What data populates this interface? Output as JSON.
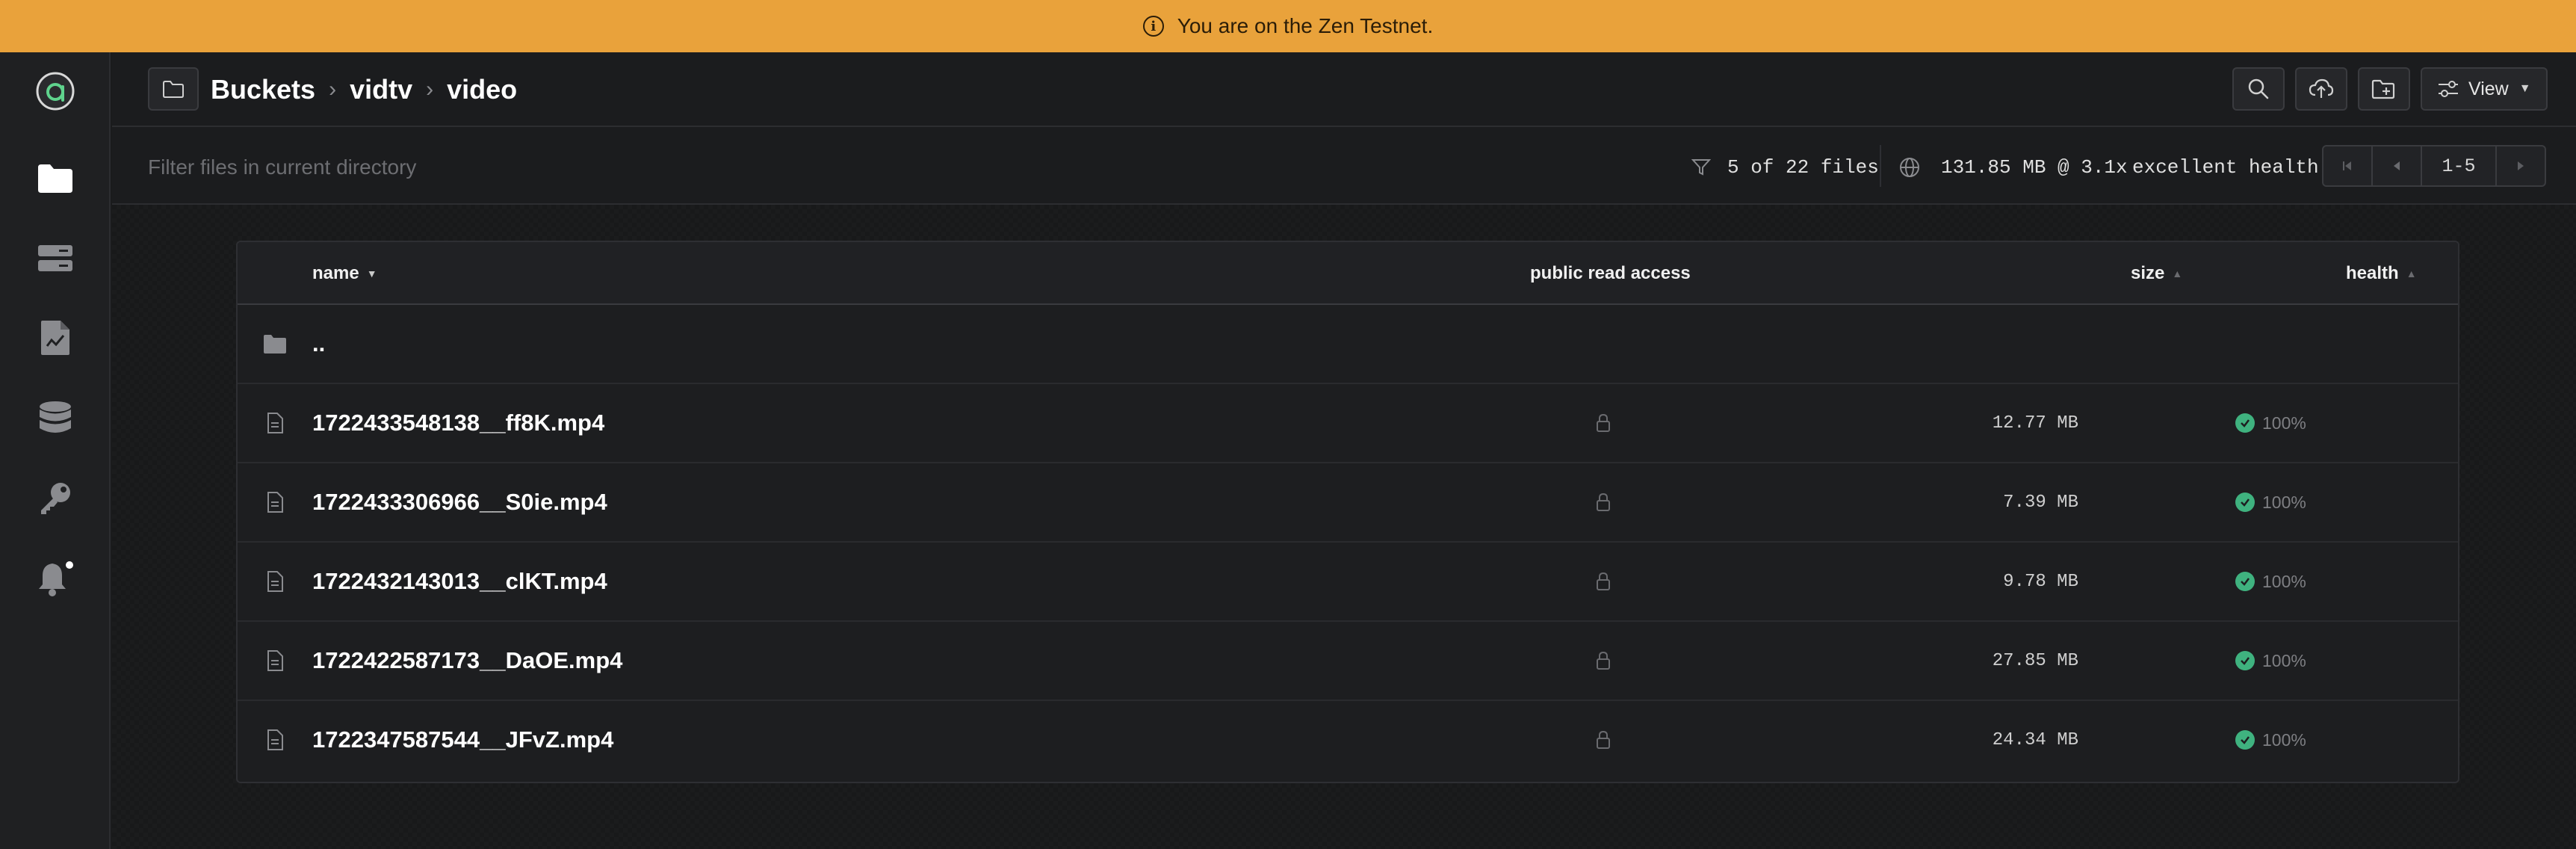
{
  "banner": {
    "text": "You are on the Zen Testnet."
  },
  "sidebar": {
    "items": [
      {
        "icon": "logo-icon"
      },
      {
        "icon": "folder-icon",
        "active": true
      },
      {
        "icon": "server-icon"
      },
      {
        "icon": "file-chart-icon"
      },
      {
        "icon": "database-icon"
      },
      {
        "icon": "key-icon"
      },
      {
        "icon": "bell-icon"
      }
    ]
  },
  "breadcrumb": {
    "root": "Buckets",
    "bucket": "vidtv",
    "folder": "video"
  },
  "toolbar": {
    "view_label": "View"
  },
  "filter": {
    "placeholder": "Filter files in current directory",
    "file_count": "5 of 22 files",
    "stats": "131.85 MB @ 3.1x",
    "health_text": "excellent health",
    "page_range": "1-5"
  },
  "table": {
    "columns": {
      "name": "name",
      "access": "public read access",
      "size": "size",
      "health": "health"
    },
    "parent_dir": "..",
    "rows": [
      {
        "name": "1722433548138__ff8K.mp4",
        "size": "12.77 MB",
        "health": "100%"
      },
      {
        "name": "1722433306966__S0ie.mp4",
        "size": "7.39 MB",
        "health": "100%"
      },
      {
        "name": "1722432143013__clKT.mp4",
        "size": "9.78 MB",
        "health": "100%"
      },
      {
        "name": "1722422587173__DaOE.mp4",
        "size": "27.85 MB",
        "health": "100%"
      },
      {
        "name": "1722347587544__JFvZ.mp4",
        "size": "24.34 MB",
        "health": "100%"
      }
    ]
  },
  "colors": {
    "banner": "#e9a23b",
    "health_ok": "#3fb27f",
    "logo_accent": "#5fd38d"
  }
}
